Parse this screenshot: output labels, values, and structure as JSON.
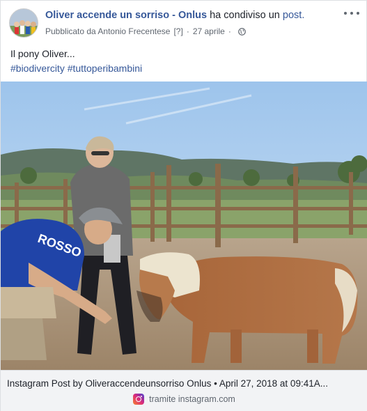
{
  "header": {
    "page_name": "Oliver accende un sorriso - Onlus",
    "shared_text": "ha condiviso un",
    "shared_link": "post.",
    "published_by": "Pubblicato da Antonio Frecentese",
    "help_marker": "[?]",
    "date": "27 aprile",
    "privacy_icon": "globe-icon",
    "more_icon": "more-options-icon"
  },
  "post": {
    "text": "Il pony Oliver...",
    "hashtags": [
      "#biodivercity",
      "#tuttoperibambini"
    ]
  },
  "photo": {
    "alt": "pony-with-people-photo",
    "shirt_text": "ROSSO"
  },
  "caption": {
    "title": "Instagram Post by Oliveraccendeunsorriso Onlus • April 27, 2018 at 09:41A...",
    "source": "tramite instagram.com",
    "source_icon": "instagram-icon"
  },
  "colors": {
    "link": "#365899",
    "meta": "#606770",
    "caption_bg": "#f2f3f5"
  }
}
